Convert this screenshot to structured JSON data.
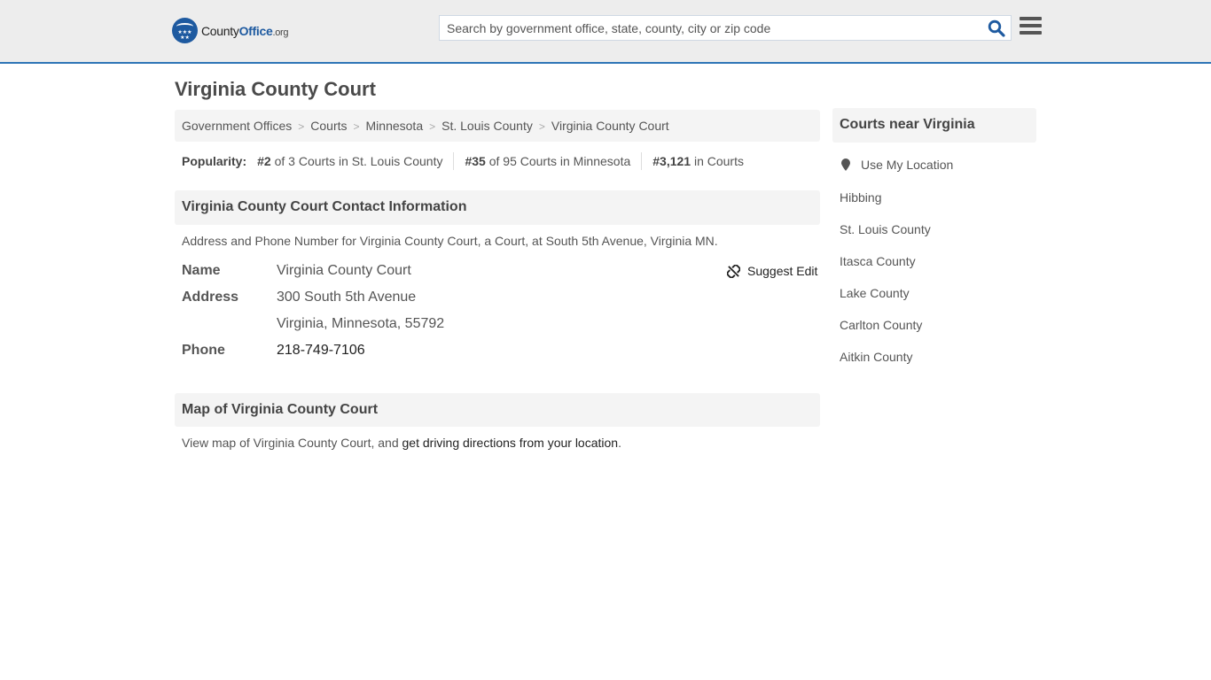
{
  "header": {
    "logo_text_county": "County",
    "logo_text_office": "Office",
    "logo_text_org": ".org",
    "search_placeholder": "Search by government office, state, county, city or zip code",
    "search_value": "",
    "icons": {
      "search": "search-icon",
      "menu": "hamburger-menu-icon",
      "logo": "eagle-stars-icon"
    },
    "accent_color": "#2e75b6"
  },
  "page": {
    "title": "Virginia County Court"
  },
  "breadcrumb": [
    {
      "label": "Government Offices"
    },
    {
      "label": "Courts"
    },
    {
      "label": "Minnesota"
    },
    {
      "label": "St. Louis County"
    },
    {
      "label": "Virginia County Court"
    }
  ],
  "popularity": {
    "label": "Popularity:",
    "items": [
      {
        "rank": "#2",
        "text": " of 3 Courts in St. Louis County"
      },
      {
        "rank": "#35",
        "text": " of 95 Courts in Minnesota"
      },
      {
        "rank": "#3,121",
        "text": " in Courts"
      }
    ]
  },
  "contact": {
    "heading": "Virginia County Court Contact Information",
    "description": "Address and Phone Number for Virginia County Court, a Court, at South 5th Avenue, Virginia MN.",
    "suggest_edit": "Suggest Edit",
    "rows": {
      "name_label": "Name",
      "name_value": "Virginia County Court",
      "address_label": "Address",
      "address_line1": "300 South 5th Avenue",
      "address_line2": "Virginia, Minnesota, 55792",
      "phone_label": "Phone",
      "phone_value": "218-749-7106"
    }
  },
  "map": {
    "heading": "Map of Virginia County Court",
    "description_prefix": "View map of Virginia County Court, and ",
    "directions_link": "get driving directions from your location",
    "description_suffix": "."
  },
  "sidebar": {
    "heading": "Courts near Virginia",
    "use_location": "Use My Location",
    "links": [
      {
        "label": "Hibbing"
      },
      {
        "label": "St. Louis County"
      },
      {
        "label": "Itasca County"
      },
      {
        "label": "Lake County"
      },
      {
        "label": "Carlton County"
      },
      {
        "label": "Aitkin County"
      }
    ]
  }
}
